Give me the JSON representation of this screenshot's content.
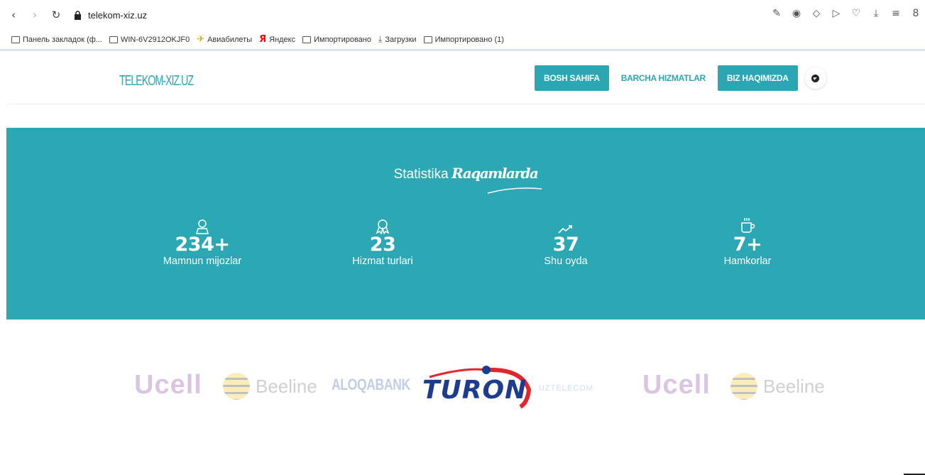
{
  "browser": {
    "url": "telekom-xiz.uz",
    "bookmarks": [
      {
        "label": "Панель закладок (ф...",
        "icon": "folder-icon"
      },
      {
        "label": "WIN-6V2912OKJF0",
        "icon": "folder-icon"
      },
      {
        "label": "Авиабилеты",
        "icon": "plane-icon"
      },
      {
        "label": "Яндекс",
        "icon": "yandex-icon"
      },
      {
        "label": "Импортировано",
        "icon": "folder-icon"
      },
      {
        "label": "Загрузки",
        "icon": "download-icon"
      },
      {
        "label": "Импортировано (1)",
        "icon": "folder-icon"
      }
    ]
  },
  "site": {
    "logo": "TELEKOM-XIZ.UZ",
    "nav": {
      "home": "BOSH SAHIFA",
      "services": "BARCHA HIZMATLAR",
      "about": "BIZ HAQIMIZDA"
    },
    "stats_title_part1": "Statistika",
    "stats_title_part2": "Raqamlarda",
    "stats": [
      {
        "icon": "user-icon",
        "value": "234+",
        "label": "Mamnun mijozlar"
      },
      {
        "icon": "award-icon",
        "value": "23",
        "label": "Hizmat turlari"
      },
      {
        "icon": "trend-icon",
        "value": "37",
        "label": "Shu oyda"
      },
      {
        "icon": "coffee-icon",
        "value": "7+",
        "label": "Hamkorlar"
      }
    ],
    "partners": {
      "ucell": "Ucell",
      "beeline": "Beeline",
      "aloqabank": "ALOQABANK",
      "turon": "TURON",
      "uztelecom": "UZTELECOM"
    }
  },
  "colors": {
    "accent": "#2ba8b4",
    "turon_red": "#e3262b",
    "turon_blue": "#1b3c8f"
  }
}
